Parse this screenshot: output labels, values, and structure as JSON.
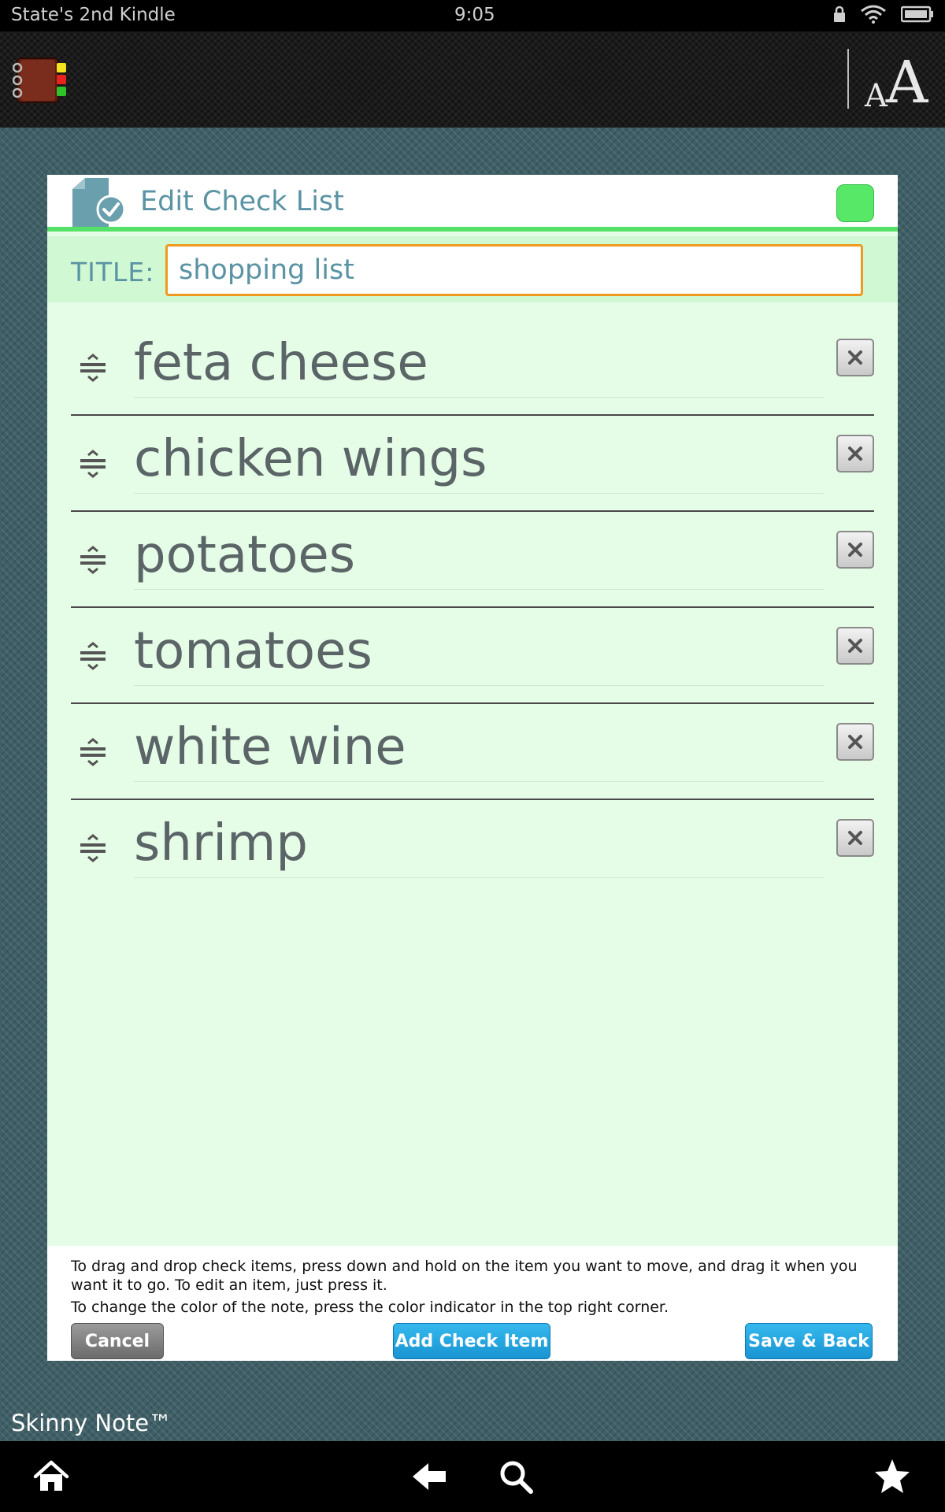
{
  "status_bar": {
    "device_name": "State's 2nd Kindle",
    "time": "9:05",
    "icons": [
      "lock-icon",
      "wifi-icon",
      "battery-icon"
    ]
  },
  "app_header": {
    "app_icon": "notebook-icon",
    "font_size_icon": {
      "small": "A",
      "big": "A"
    }
  },
  "dialog": {
    "title": "Edit Check List",
    "header_icon": "document-check-icon",
    "note_color": "#58e868",
    "title_label": "TITLE:",
    "title_value": "shopping list",
    "items": [
      {
        "label": "feta cheese"
      },
      {
        "label": "chicken wings"
      },
      {
        "label": "potatoes"
      },
      {
        "label": "tomatoes"
      },
      {
        "label": "white wine"
      },
      {
        "label": "shrimp"
      }
    ],
    "help_lines": [
      "To drag and drop check items, press down and hold on the item you want to move, and drag it when you want it to go. To edit an item, just press it.",
      "To change the color of the note, press the color indicator in the top right corner."
    ],
    "buttons": {
      "cancel": "Cancel",
      "add": "Add Check Item",
      "save": "Save & Back"
    }
  },
  "brand": "Skinny Note™",
  "nav_bar": {
    "icons": [
      "home-icon",
      "back-icon",
      "search-icon",
      "star-icon"
    ]
  },
  "colors": {
    "accent_green": "#55e068",
    "title_input_border": "#ef9a1e",
    "button_blue": "#1ea5e0",
    "dialog_bg": "#e5fde7"
  }
}
